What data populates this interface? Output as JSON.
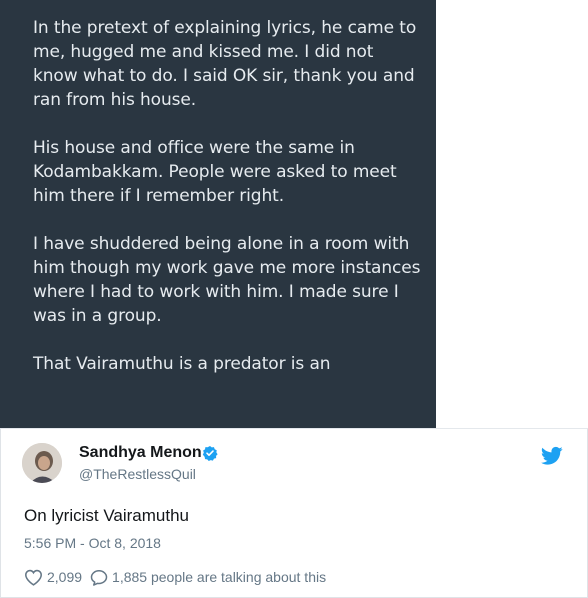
{
  "screenshot": {
    "paragraphs": [
      "In the pretext of explaining lyrics, he came to me, hugged me and kissed me. I did not know what to do. I said OK sir, thank you and ran from his house.",
      "His house and office were the same in Kodambakkam. People were asked to meet him there if I remember right.",
      "I have shuddered being alone in a room with him though my work gave me more instances where I had to work with him. I made sure I was in a group.",
      "That Vairamuthu is a predator is an"
    ]
  },
  "tweet": {
    "display_name": "Sandhya Menon",
    "handle": "@TheRestlessQuil",
    "text": "On lyricist Vairamuthu",
    "timestamp": "5:56 PM - Oct 8, 2018",
    "likes": "2,099",
    "talking": "1,885 people are talking about this",
    "icons": {
      "verified": "verified-badge-icon",
      "platform": "twitter-bird-icon",
      "like": "heart-icon",
      "reply": "speech-bubble-icon"
    },
    "colors": {
      "accent": "#1da1f2",
      "panel_bg": "#2a3641",
      "muted_text": "#657786"
    }
  }
}
